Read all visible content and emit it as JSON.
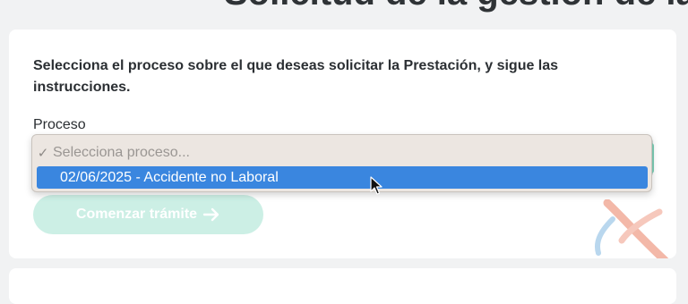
{
  "page": {
    "heading_partial": "Solicitud de la gestión de la prestación"
  },
  "form": {
    "instructions": "Selecciona el proceso sobre el que deseas solicitar la Prestación, y sigue las instrucciones.",
    "process_label": "Proceso",
    "start_button_label": "Comenzar trámite",
    "start_button_icon": "arrow-right-icon"
  },
  "dropdown": {
    "placeholder_option": "Selecciona proceso...",
    "placeholder_icon": "checkmark-icon",
    "options": [
      {
        "label": "02/06/2025 - Accidente no Laboral",
        "highlighted": true
      }
    ]
  },
  "colors": {
    "accent_green": "#7fd0b8",
    "button_disabled": "#ccefe5",
    "highlight_blue": "#3a86df",
    "popup_background": "#ece6e1",
    "logo_red": "#f0a08e",
    "logo_blue": "#9cc7e8"
  }
}
